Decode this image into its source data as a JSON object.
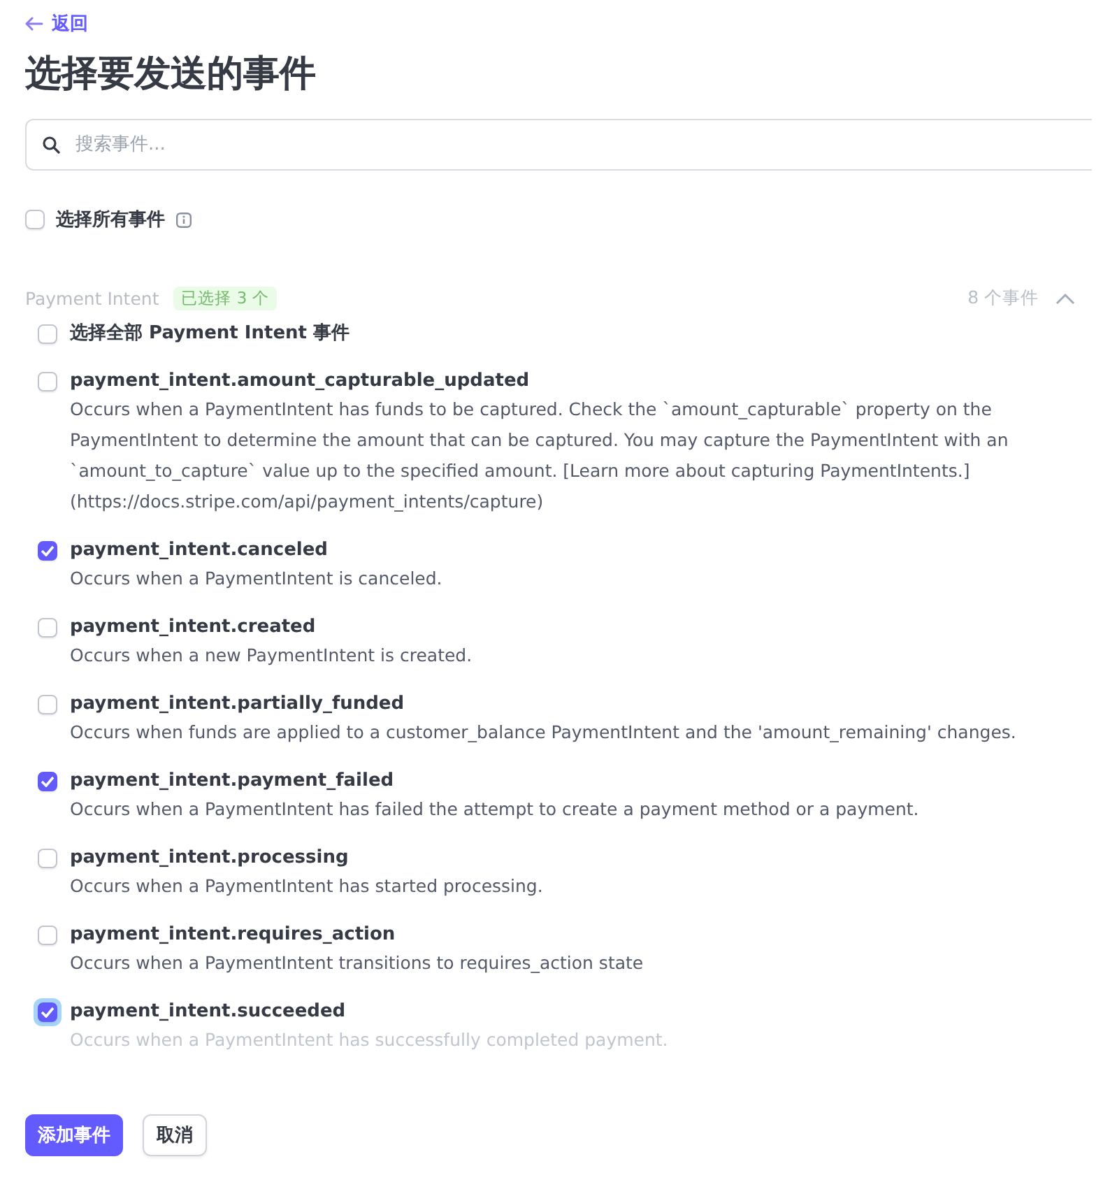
{
  "back_link": {
    "label": "返回"
  },
  "title": "选择要发送的事件",
  "search": {
    "placeholder": "搜索事件..."
  },
  "select_all": {
    "label": "选择所有事件",
    "checked": false
  },
  "group": {
    "name": "Payment Intent",
    "badge": "已选择 3 个",
    "count": "8 个事件",
    "expanded": true,
    "select_group": {
      "label": "选择全部 Payment Intent 事件",
      "checked": false
    },
    "events": [
      {
        "name": "payment_intent.amount_capturable_updated",
        "description": "Occurs when a PaymentIntent has funds to be captured. Check the `amount_capturable` property on the PaymentIntent to determine the amount that can be captured. You may capture the PaymentIntent with an `amount_to_capture` value up to the specified amount. [Learn more about capturing PaymentIntents.](https://docs.stripe.com/api/payment_intents/capture)",
        "checked": false,
        "focused": false,
        "faded": false
      },
      {
        "name": "payment_intent.canceled",
        "description": "Occurs when a PaymentIntent is canceled.",
        "checked": true,
        "focused": false,
        "faded": false
      },
      {
        "name": "payment_intent.created",
        "description": "Occurs when a new PaymentIntent is created.",
        "checked": false,
        "focused": false,
        "faded": false
      },
      {
        "name": "payment_intent.partially_funded",
        "description": "Occurs when funds are applied to a customer_balance PaymentIntent and the 'amount_remaining' changes.",
        "checked": false,
        "focused": false,
        "faded": false
      },
      {
        "name": "payment_intent.payment_failed",
        "description": "Occurs when a PaymentIntent has failed the attempt to create a payment method or a payment.",
        "checked": true,
        "focused": false,
        "faded": false
      },
      {
        "name": "payment_intent.processing",
        "description": "Occurs when a PaymentIntent has started processing.",
        "checked": false,
        "focused": false,
        "faded": false
      },
      {
        "name": "payment_intent.requires_action",
        "description": "Occurs when a PaymentIntent transitions to requires_action state",
        "checked": false,
        "focused": false,
        "faded": false
      },
      {
        "name": "payment_intent.succeeded",
        "description": "Occurs when a PaymentIntent has successfully completed payment.",
        "checked": true,
        "focused": true,
        "faded": true
      }
    ]
  },
  "buttons": {
    "primary": "添加事件",
    "secondary": "取消"
  }
}
